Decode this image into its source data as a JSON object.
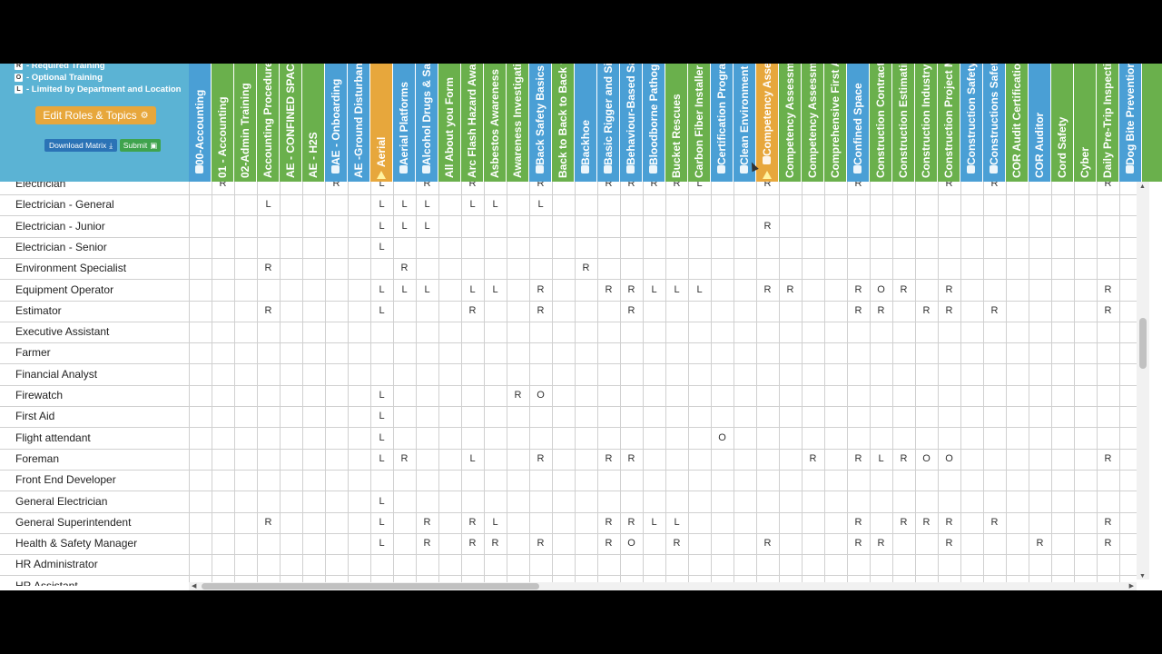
{
  "legend": {
    "items": [
      {
        "key": "R",
        "text": "- Required Training"
      },
      {
        "key": "O",
        "text": "- Optional Training"
      },
      {
        "key": "L",
        "text": "- Limited by Department and Location"
      }
    ],
    "edit_roles_label": "Edit Roles & Topics",
    "download_label": "Download Matrix",
    "submit_label": "Submit"
  },
  "colors": {
    "blue": "#4a9fd5",
    "green": "#6ab04c",
    "orange": "#e7a73c",
    "panel": "#5bb3d4"
  },
  "columns": [
    {
      "label": "00-Accounting",
      "color": "blue",
      "icon": true
    },
    {
      "label": "01 - Accounting",
      "color": "green",
      "icon": false
    },
    {
      "label": "02-Admin Training",
      "color": "green",
      "icon": false
    },
    {
      "label": "Accounting Procedures",
      "color": "green",
      "icon": false
    },
    {
      "label": "AE - CONFINED SPACE",
      "color": "green",
      "icon": false
    },
    {
      "label": "AE - H2S",
      "color": "green",
      "icon": false
    },
    {
      "label": "AE - Onboarding",
      "color": "blue",
      "icon": true
    },
    {
      "label": "AE -Ground Disturbance",
      "color": "blue",
      "icon": false
    },
    {
      "label": "Aerial",
      "color": "orange",
      "icon": false,
      "warning": true
    },
    {
      "label": "Aerial Platforms",
      "color": "blue",
      "icon": true
    },
    {
      "label": "Alcohol Drugs & Safety",
      "color": "blue",
      "icon": true
    },
    {
      "label": "All About you Form",
      "color": "green",
      "icon": false
    },
    {
      "label": "Arc Flash Hazard Awareness",
      "color": "green",
      "icon": false
    },
    {
      "label": "Asbestos Awareness",
      "color": "green",
      "icon": false
    },
    {
      "label": "Awareness Investigation",
      "color": "green",
      "icon": false
    },
    {
      "label": "Back Safety Basics",
      "color": "blue",
      "icon": true
    },
    {
      "label": "Back to Back to Back to",
      "color": "green",
      "icon": false
    },
    {
      "label": "Backhoe",
      "color": "blue",
      "icon": true
    },
    {
      "label": "Basic Rigger and Signal",
      "color": "blue",
      "icon": true
    },
    {
      "label": "Behaviour-Based Safety",
      "color": "blue",
      "icon": true
    },
    {
      "label": "Bloodborne Pathogens",
      "color": "blue",
      "icon": true
    },
    {
      "label": "Bucket Rescues",
      "color": "green",
      "icon": false
    },
    {
      "label": "Carbon Fiber Installer",
      "color": "green",
      "icon": false
    },
    {
      "label": "Certification Program",
      "color": "blue",
      "icon": true
    },
    {
      "label": "Clean Environment",
      "color": "blue",
      "icon": true
    },
    {
      "label": "Competency Assessment",
      "color": "orange",
      "icon": true,
      "warning": true
    },
    {
      "label": "Competency Assessment",
      "color": "green",
      "icon": false
    },
    {
      "label": "Competency Assessment",
      "color": "green",
      "icon": false
    },
    {
      "label": "Comprehensive First Aid",
      "color": "green",
      "icon": false
    },
    {
      "label": "Confined Space",
      "color": "blue",
      "icon": true
    },
    {
      "label": "Construction Contract Admin",
      "color": "green",
      "icon": false
    },
    {
      "label": "Construction Estimating",
      "color": "green",
      "icon": false
    },
    {
      "label": "Construction Industry Basics",
      "color": "green",
      "icon": false
    },
    {
      "label": "Construction Project Management",
      "color": "green",
      "icon": false
    },
    {
      "label": "Construction Safety",
      "color": "blue",
      "icon": true
    },
    {
      "label": "Constructions Safety",
      "color": "blue",
      "icon": true
    },
    {
      "label": "COR Audit Certification",
      "color": "green",
      "icon": false
    },
    {
      "label": "COR Auditor",
      "color": "blue",
      "icon": false
    },
    {
      "label": "Cord Safety",
      "color": "green",
      "icon": false
    },
    {
      "label": "Cyber",
      "color": "green",
      "icon": false
    },
    {
      "label": "Daily Pre-Trip Inspection",
      "color": "green",
      "icon": false
    },
    {
      "label": "Dog Bite Prevention",
      "color": "blue",
      "icon": true
    },
    {
      "label": "",
      "color": "green",
      "icon": false
    }
  ],
  "rows": [
    {
      "name": "Electrician",
      "cells": {
        "1": "R",
        "6": "R",
        "8": "L",
        "10": "R",
        "12": "R",
        "15": "R",
        "18": "R",
        "19": "R",
        "20": "R",
        "21": "R",
        "22": "L",
        "25": "R",
        "29": "R",
        "33": "R",
        "35": "R",
        "40": "R"
      }
    },
    {
      "name": "Electrician - General",
      "cells": {
        "3": "L",
        "8": "L",
        "9": "L",
        "10": "L",
        "12": "L",
        "13": "L",
        "15": "L"
      }
    },
    {
      "name": "Electrician - Junior",
      "cells": {
        "8": "L",
        "9": "L",
        "10": "L",
        "25": "R"
      }
    },
    {
      "name": "Electrician - Senior",
      "cells": {
        "8": "L"
      }
    },
    {
      "name": "Environment Specialist",
      "cells": {
        "3": "R",
        "9": "R",
        "17": "R"
      }
    },
    {
      "name": "Equipment Operator",
      "cells": {
        "8": "L",
        "9": "L",
        "10": "L",
        "12": "L",
        "13": "L",
        "15": "R",
        "18": "R",
        "19": "R",
        "20": "L",
        "21": "L",
        "22": "L",
        "25": "R",
        "26": "R",
        "29": "R",
        "30": "O",
        "31": "R",
        "33": "R",
        "40": "R"
      }
    },
    {
      "name": "Estimator",
      "cells": {
        "3": "R",
        "8": "L",
        "12": "R",
        "15": "R",
        "19": "R",
        "29": "R",
        "30": "R",
        "32": "R",
        "33": "R",
        "35": "R",
        "40": "R"
      }
    },
    {
      "name": "Executive Assistant",
      "cells": {}
    },
    {
      "name": "Farmer",
      "cells": {}
    },
    {
      "name": "Financial Analyst",
      "cells": {}
    },
    {
      "name": "Firewatch",
      "cells": {
        "8": "L",
        "14": "R",
        "15": "O"
      }
    },
    {
      "name": "First Aid",
      "cells": {
        "8": "L"
      }
    },
    {
      "name": "Flight attendant",
      "cells": {
        "8": "L",
        "23": "O"
      }
    },
    {
      "name": "Foreman",
      "cells": {
        "8": "L",
        "9": "R",
        "12": "L",
        "15": "R",
        "18": "R",
        "19": "R",
        "27": "R",
        "29": "R",
        "30": "L",
        "31": "R",
        "32": "O",
        "33": "O",
        "40": "R"
      }
    },
    {
      "name": "Front End Developer",
      "cells": {}
    },
    {
      "name": "General Electrician",
      "cells": {
        "8": "L"
      }
    },
    {
      "name": "General Superintendent",
      "cells": {
        "3": "R",
        "8": "L",
        "10": "R",
        "12": "R",
        "13": "L",
        "18": "R",
        "19": "R",
        "20": "L",
        "21": "L",
        "29": "R",
        "31": "R",
        "32": "R",
        "33": "R",
        "35": "R",
        "40": "R"
      }
    },
    {
      "name": "Health & Safety Manager",
      "cells": {
        "8": "L",
        "10": "R",
        "12": "R",
        "13": "R",
        "15": "R",
        "18": "R",
        "19": "O",
        "21": "R",
        "25": "R",
        "29": "R",
        "30": "R",
        "33": "R",
        "37": "R",
        "40": "R"
      }
    },
    {
      "name": "HR Administrator",
      "cells": {}
    },
    {
      "name": "HR Assistant",
      "cells": {}
    }
  ]
}
